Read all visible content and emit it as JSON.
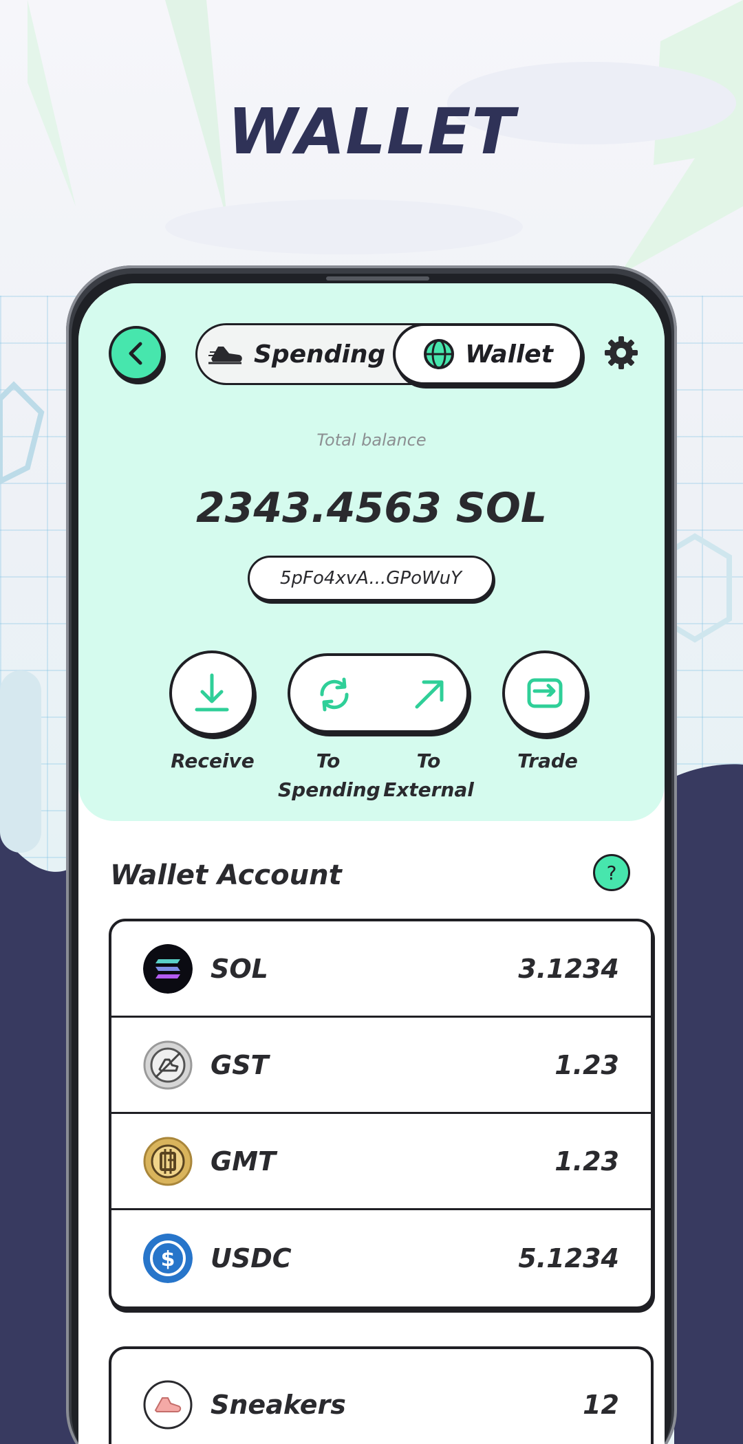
{
  "page": {
    "title": "WALLET"
  },
  "header": {
    "tabs": [
      {
        "label": "Spending",
        "icon": "sneaker-icon",
        "active": false
      },
      {
        "label": "Wallet",
        "icon": "globe-icon",
        "active": true
      }
    ]
  },
  "balance": {
    "label": "Total balance",
    "amount": "2343.4563 SOL",
    "address": "5pFo4xvA...GPoWuY"
  },
  "actions": {
    "receive": "Receive",
    "to_spending": [
      "To",
      "Spending"
    ],
    "to_external": [
      "To",
      "External"
    ],
    "trade": "Trade"
  },
  "wallet_account": {
    "title": "Wallet Account",
    "help": "?",
    "tokens": [
      {
        "name": "SOL",
        "value": "3.1234",
        "icon": "solana-icon"
      },
      {
        "name": "GST",
        "value": "1.23",
        "icon": "gst-icon"
      },
      {
        "name": "GMT",
        "value": "1.23",
        "icon": "gmt-icon"
      },
      {
        "name": "USDC",
        "value": "5.1234",
        "icon": "usdc-icon"
      }
    ],
    "sneakers": {
      "name": "Sneakers",
      "value": "12",
      "icon": "sneaker-icon"
    }
  },
  "colors": {
    "accent": "#47e6ad",
    "panel": "#d5fbee",
    "navy": "#383a60",
    "ink": "#1f1f24"
  }
}
